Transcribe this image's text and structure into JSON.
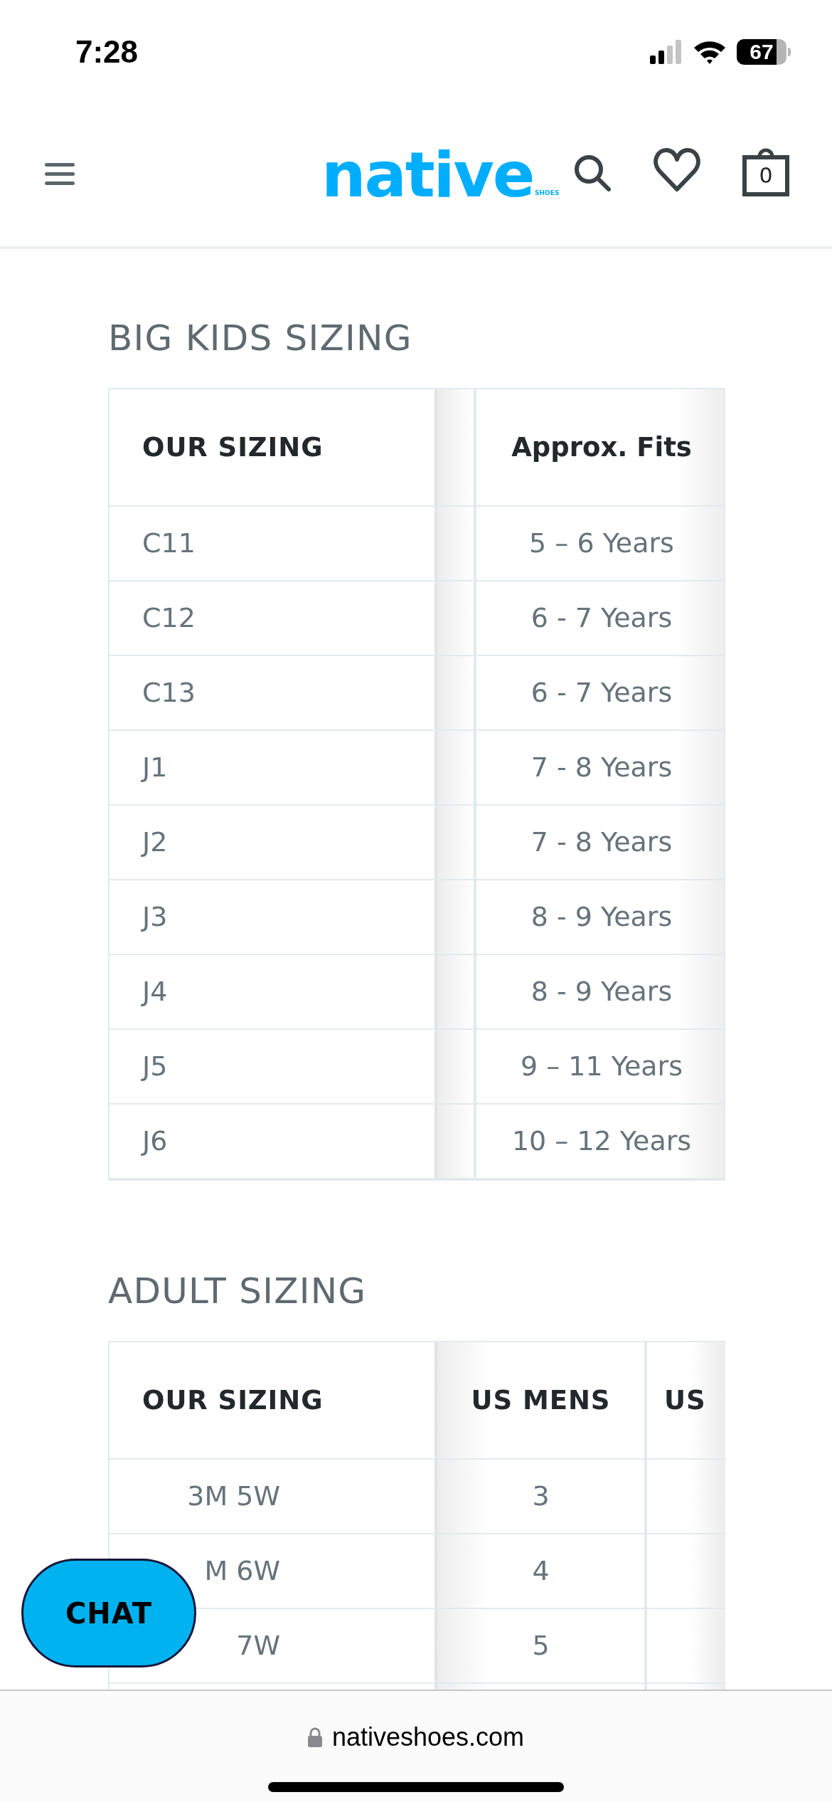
{
  "status_bar": {
    "time": "7:28",
    "battery": "67"
  },
  "header": {
    "logo": "native",
    "logo_sub": "SHOES",
    "cart_count": "0"
  },
  "big_kids": {
    "title": "BIG KIDS SIZING",
    "columns": [
      "OUR SIZING",
      "Approx. Fits"
    ],
    "rows": [
      {
        "cells": [
          "C11",
          "5 – 6 Years"
        ]
      },
      {
        "cells": [
          "C12",
          "6 - 7 Years"
        ]
      },
      {
        "cells": [
          "C13",
          "6 - 7 Years"
        ]
      },
      {
        "cells": [
          "J1",
          "7 - 8 Years"
        ]
      },
      {
        "cells": [
          "J2",
          "7 - 8 Years"
        ]
      },
      {
        "cells": [
          "J3",
          "8 - 9 Years"
        ]
      },
      {
        "cells": [
          "J4",
          "8 - 9 Years"
        ]
      },
      {
        "cells": [
          "J5",
          "9 – 11 Years"
        ]
      },
      {
        "cells": [
          "J6",
          "10 – 12 Years"
        ]
      }
    ]
  },
  "adult": {
    "title": "ADULT SIZING",
    "columns": [
      "OUR SIZING",
      "US MENS",
      "US"
    ],
    "rows": [
      {
        "cells": [
          "3M 5W",
          "3"
        ]
      },
      {
        "cells": [
          "M 6W",
          "4"
        ]
      },
      {
        "cells": [
          "7W",
          "5"
        ]
      }
    ]
  },
  "chat_button": {
    "label": "CHAT"
  },
  "browser_bar": {
    "url": "nativeshoes.com"
  }
}
